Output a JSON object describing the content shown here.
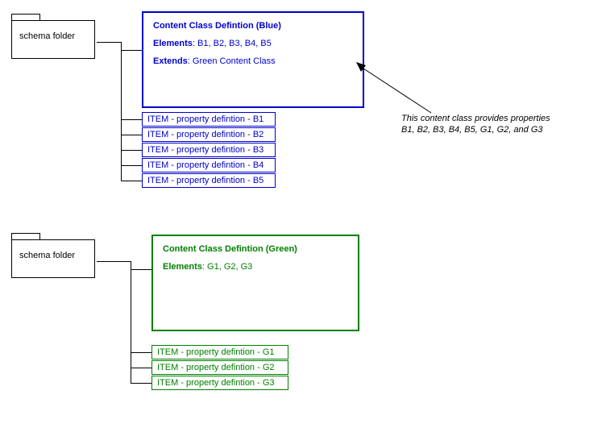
{
  "folder1": {
    "label": "schema folder"
  },
  "folder2": {
    "label": "schema folder"
  },
  "blueBox": {
    "title": "Content Class Defintion (Blue)",
    "elementsLabel": "Elements",
    "elementsValue": ": B1, B2, B3, B4, B5",
    "extendsLabel": "Extends",
    "extendsValue": ": Green Content Class"
  },
  "blueItems": [
    "ITEM - property defintion - B1",
    "ITEM - property defintion - B2",
    "ITEM - property defintion - B3",
    "ITEM - property defintion - B4",
    "ITEM - property defintion - B5"
  ],
  "greenBox": {
    "title": "Content Class Defintion (Green)",
    "elementsLabel": "Elements",
    "elementsValue": ": G1, G2, G3"
  },
  "greenItems": [
    "ITEM - property defintion - G1",
    "ITEM - property defintion - G2",
    "ITEM - property defintion - G3"
  ],
  "annotation": {
    "line1": "This content class provides properties",
    "line2": "B1, B2, B3, B4, B5, G1, G2, and G3"
  }
}
